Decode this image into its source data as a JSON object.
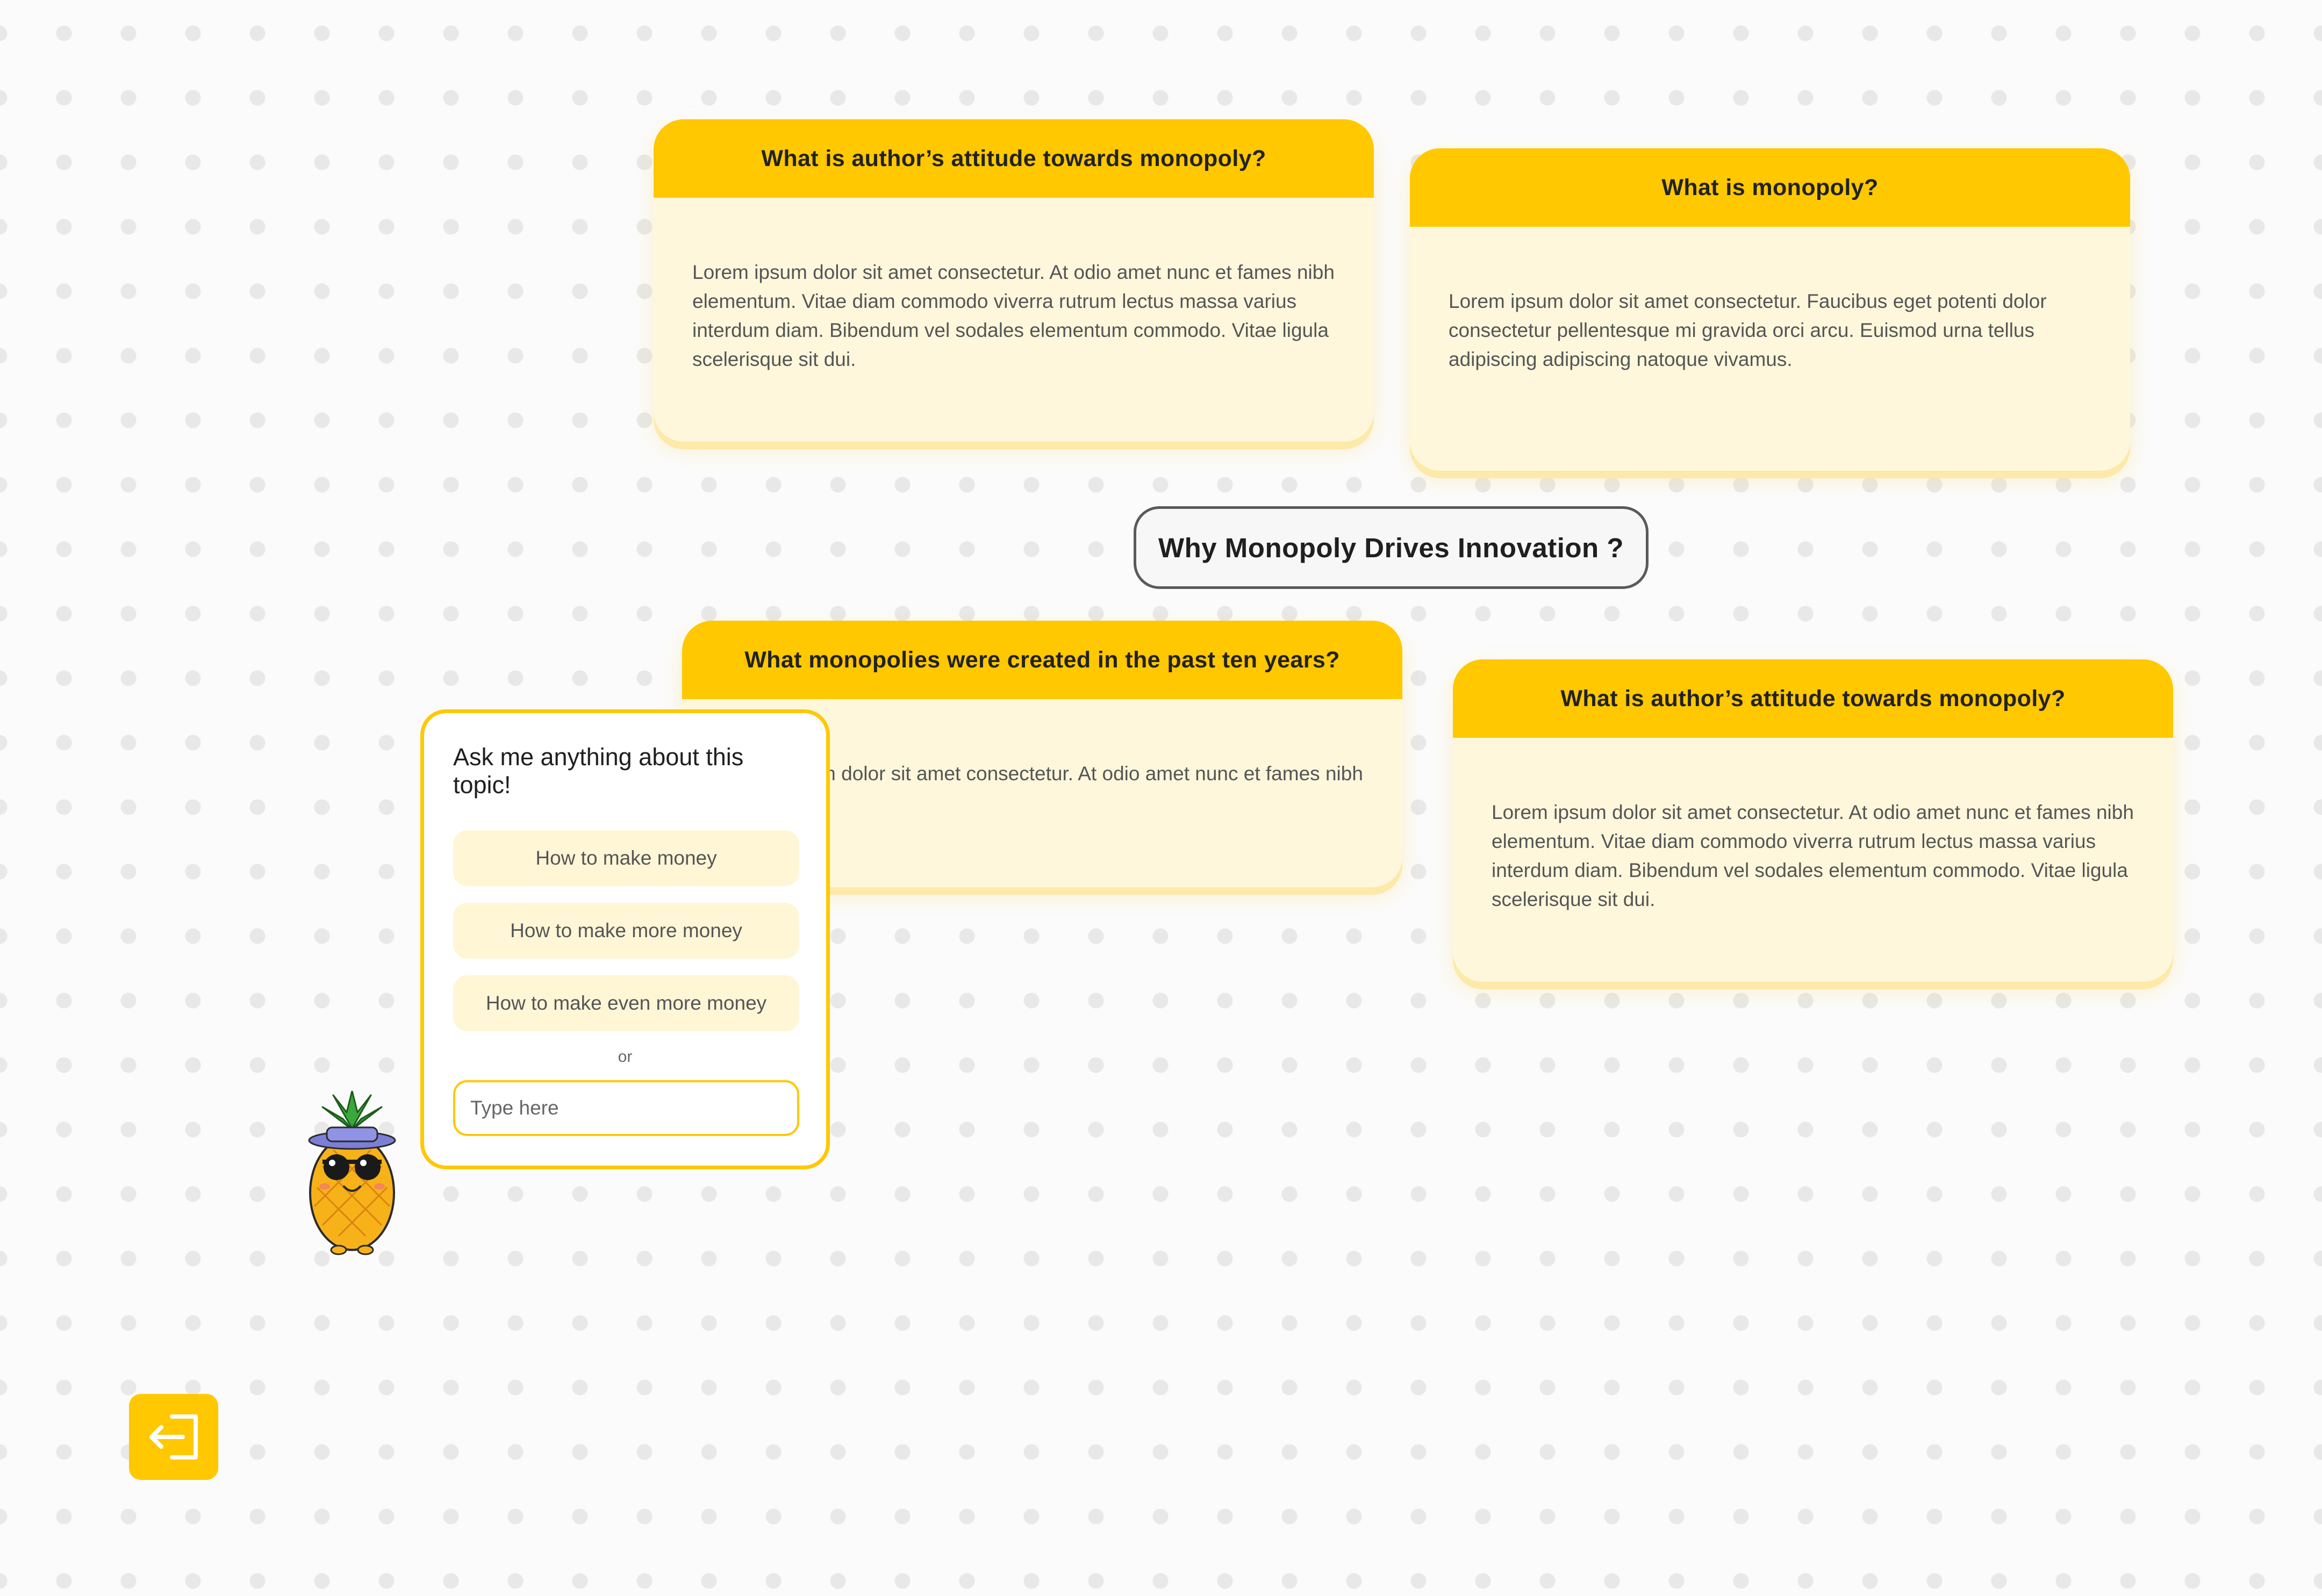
{
  "topic": {
    "title": "Why Monopoly Drives Innovation ?"
  },
  "cards": [
    {
      "question": "What is author’s attitude towards monopoly?",
      "answer": "Lorem ipsum dolor sit amet consectetur. At odio amet nunc et fames nibh elementum. Vitae diam commodo viverra rutrum lectus massa varius interdum diam. Bibendum vel sodales elementum commodo. Vitae ligula scelerisque sit dui."
    },
    {
      "question": "What is monopoly?",
      "answer": "Lorem ipsum dolor sit amet consectetur. Faucibus eget potenti dolor consectetur pellentesque mi gravida orci arcu. Euismod urna tellus adipiscing adipiscing natoque vivamus."
    },
    {
      "question": "What monopolies were created in the past ten years?",
      "answer": "Lorem ipsum dolor sit amet consectetur. At odio amet nunc et fames nibh elementum."
    },
    {
      "question": "What is author’s attitude towards monopoly?",
      "answer": "Lorem ipsum dolor sit amet consectetur. At odio amet nunc et fames nibh elementum. Vitae diam commodo viverra rutrum lectus massa varius interdum diam. Bibendum vel sodales elementum commodo. Vitae ligula scelerisque sit dui."
    }
  ],
  "assistant": {
    "title": "Ask me anything about this topic!",
    "suggestions": [
      "How to make money",
      "How to make more money",
      "How to make even more money"
    ],
    "or_label": "or",
    "input_placeholder": "Type here",
    "mascot_icon": "pineapple-mascot-icon"
  },
  "exit_button": {
    "icon": "exit-icon"
  },
  "colors": {
    "accent": "#ffc800",
    "card_body": "#fff7dc",
    "suggestion_bg": "#fff6d6",
    "topic_border": "#5a5a5a",
    "background": "#fbfbfb"
  }
}
